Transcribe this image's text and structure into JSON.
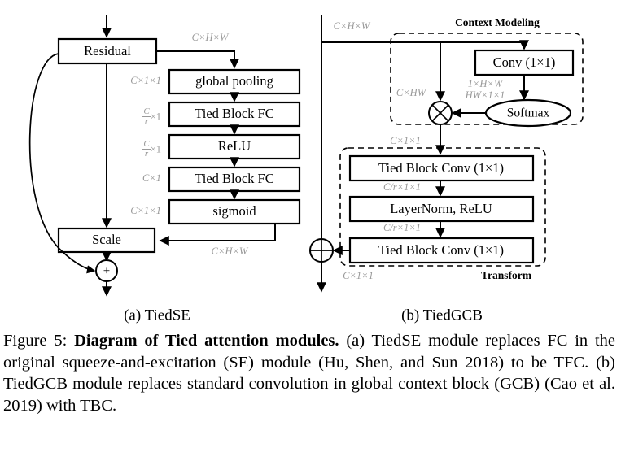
{
  "figure": {
    "number": "Figure 5:",
    "title": "Diagram of Tied attention modules.",
    "body": " (a) TiedSE module replaces FC in the original squeeze-and-excitation (SE) module (Hu, Shen, and Sun 2018) to be TFC. (b) TiedGCB module replaces standard convolution in global context block (GCB) (Cao et al. 2019) with TBC.",
    "subcaption_a": "(a) TiedSE",
    "subcaption_b": "(b) TiedGCB"
  },
  "colors": {
    "stroke": "#000000",
    "dim_label": "#9a9a9a",
    "background": "#ffffff"
  },
  "diagram_a": {
    "name": "TiedSE",
    "blocks": [
      {
        "id": "residual",
        "label": "Residual"
      },
      {
        "id": "global-pooling",
        "label": "global pooling"
      },
      {
        "id": "tied-block-fc-1",
        "label": "Tied Block FC"
      },
      {
        "id": "relu",
        "label": "ReLU"
      },
      {
        "id": "tied-block-fc-2",
        "label": "Tied Block FC"
      },
      {
        "id": "sigmoid",
        "label": "sigmoid"
      },
      {
        "id": "scale",
        "label": "Scale"
      }
    ],
    "operators": [
      {
        "id": "add",
        "symbol": "+"
      }
    ],
    "dimension_labels": {
      "residual_out": "C×H×W",
      "pooling_in": "C×1×1",
      "tfc1_in_num": "C",
      "tfc1_in_den": "r",
      "tfc1_in_suffix": "×1",
      "relu_in_num": "C",
      "relu_in_den": "r",
      "relu_in_suffix": "×1",
      "tfc2_in": "C×1",
      "sigmoid_in": "C×1×1",
      "scale_in": "C×H×W"
    }
  },
  "diagram_b": {
    "name": "TiedGCB",
    "sections": [
      {
        "id": "context-modeling",
        "title": "Context Modeling"
      },
      {
        "id": "transform",
        "title": "Transform"
      }
    ],
    "blocks": [
      {
        "id": "conv-1x1",
        "label": "Conv (1×1)"
      },
      {
        "id": "softmax",
        "label": "Softmax"
      },
      {
        "id": "tied-block-conv-1",
        "label": "Tied Block Conv (1×1)"
      },
      {
        "id": "layernorm-relu",
        "label": "LayerNorm, ReLU"
      },
      {
        "id": "tied-block-conv-2",
        "label": "Tied Block Conv (1×1)"
      }
    ],
    "operators": [
      {
        "id": "multiply",
        "symbol": "⊗"
      },
      {
        "id": "add",
        "symbol": "⊕"
      }
    ],
    "dimension_labels": {
      "input": "C×H×W",
      "mul_left": "C×HW",
      "conv_out_1": "1×H×W",
      "conv_out_2": "HW×1×1",
      "mul_out": "C×1×1",
      "tbc1_out": "C/r×1×1",
      "ln_out": "C/r×1×1",
      "final_out": "C×1×1"
    }
  }
}
